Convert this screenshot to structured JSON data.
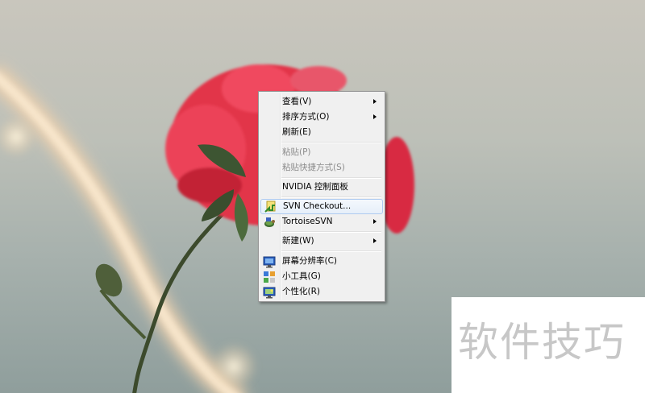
{
  "desktop": {
    "wallpaper": "rose-photo"
  },
  "context_menu": {
    "items": [
      {
        "label": "查看(V)",
        "submenu": true
      },
      {
        "label": "排序方式(O)",
        "submenu": true
      },
      {
        "label": "刷新(E)"
      },
      {
        "label": "粘贴(P)",
        "disabled": true
      },
      {
        "label": "粘贴快捷方式(S)",
        "disabled": true
      },
      {
        "label": "NVIDIA 控制面板"
      },
      {
        "label": "SVN Checkout...",
        "icon": "svn-checkout-icon",
        "highlighted": true
      },
      {
        "label": "TortoiseSVN",
        "icon": "tortoisesvn-icon",
        "submenu": true
      },
      {
        "label": "新建(W)",
        "submenu": true
      },
      {
        "label": "屏幕分辨率(C)",
        "icon": "screen-resolution-icon"
      },
      {
        "label": "小工具(G)",
        "icon": "gadgets-icon"
      },
      {
        "label": "个性化(R)",
        "icon": "personalize-icon"
      }
    ]
  },
  "watermark": {
    "text": "软件技巧"
  },
  "colors": {
    "highlight_border": "#aecaf0",
    "menu_bg": "#f0f0f0",
    "rose": "#e2344a"
  }
}
